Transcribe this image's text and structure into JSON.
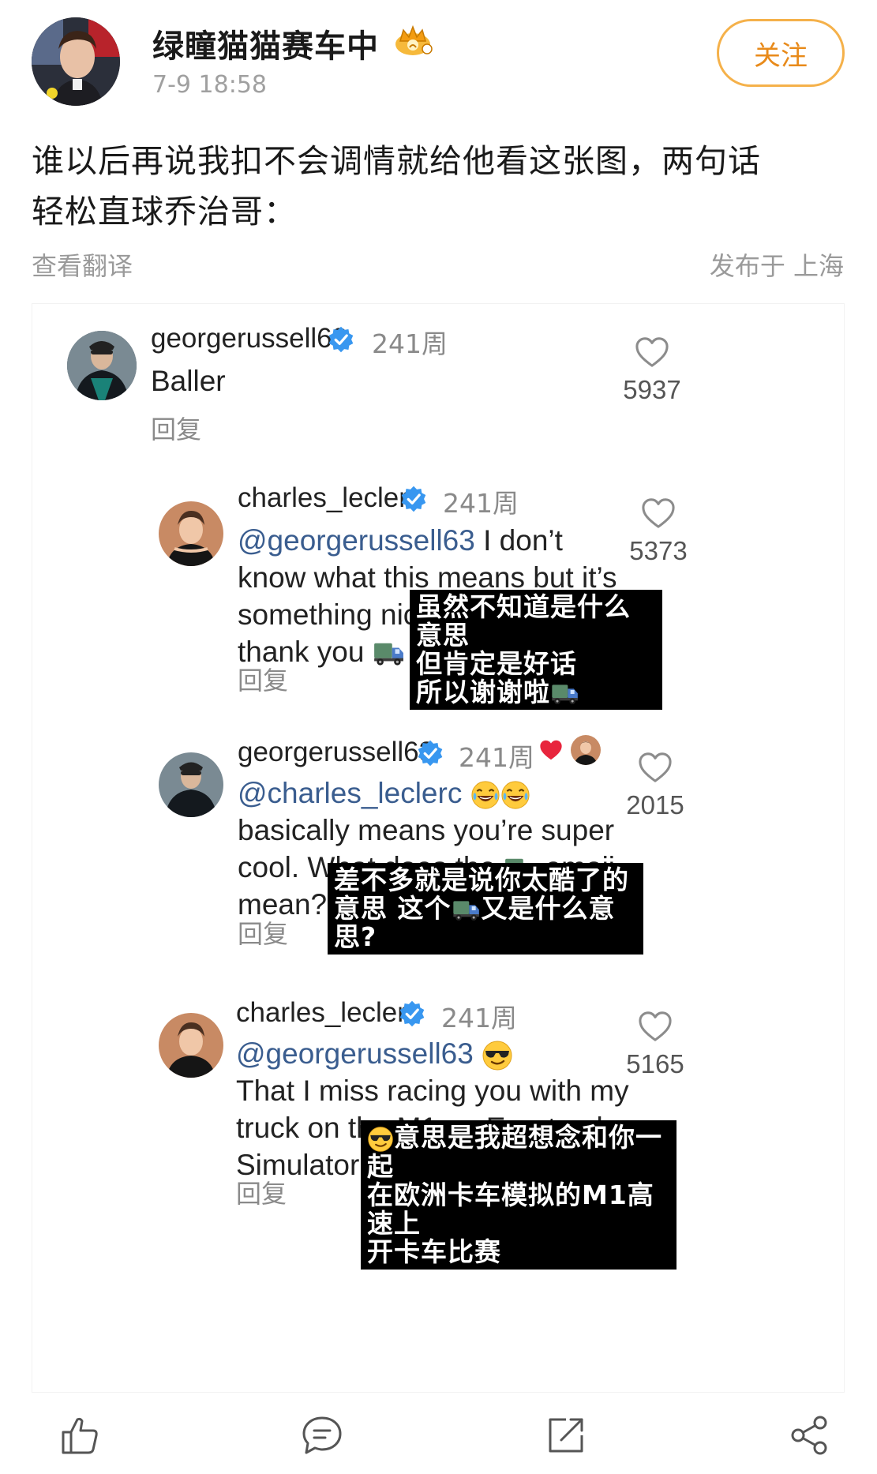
{
  "post": {
    "author": "绿瞳猫猫赛车中",
    "time": "7-9 18:58",
    "follow_label": "关注",
    "text_line1": "谁以后再说我扣不会调情就给他看这张图，两句话",
    "text_line2": "轻松直球乔治哥：",
    "translate_label": "查看翻译",
    "location": "发布于 上海"
  },
  "comments": [
    {
      "user": "georgerussell63",
      "age": "241周",
      "text": "Baller",
      "reply_label": "回复",
      "likes": "5937"
    },
    {
      "user": "charles_leclerc",
      "age": "241周",
      "mention": "@georgerussell63",
      "line1_rest": " I don’t",
      "line2": "know what this means but it’s",
      "line3": "something nice I’m sure so",
      "line4": "thank you",
      "reply_label": "回复",
      "likes": "5373",
      "subtitle": [
        "虽然不知道是什么意思",
        "但肯定是好话",
        "所以谢谢啦"
      ]
    },
    {
      "user": "georgerussell63",
      "age": "241周",
      "mention": "@charles_leclerc",
      "line2": "basically means you’re super",
      "line3a": "cool. What does the",
      "line3b": "emoji",
      "line4": "mean?",
      "reply_label": "回复",
      "likes": "2015",
      "subtitle": [
        "差不多就是说你太酷了的",
        "意思 这个",
        "又是什么意思?"
      ]
    },
    {
      "user": "charles_leclerc",
      "age": "241周",
      "mention": "@georgerussell63",
      "line2": "That I miss racing you with my",
      "line3": "truck on the M1 on Eurotruck",
      "line4": "Simulator",
      "reply_label": "回复",
      "likes": "5165",
      "subtitle": [
        "意思是我超想念和你一起",
        "在欧洲卡车模拟的M1高速上",
        "开卡车比赛"
      ]
    }
  ],
  "icons": {
    "like": "thumbs-up-icon",
    "comment": "comment-bubble-icon",
    "repost": "repost-icon",
    "share": "share-icon",
    "verified": "verified-badge-icon",
    "heart": "heart-outline-icon",
    "truck": "truck-emoji",
    "laughing": "tears-of-joy-emoji",
    "sunglasses": "sunglasses-emoji"
  },
  "colors": {
    "follow_accent": "#f5b14a",
    "mention": "#3a5d8f",
    "verified": "#3897f0",
    "muted": "#8a8a8a"
  }
}
